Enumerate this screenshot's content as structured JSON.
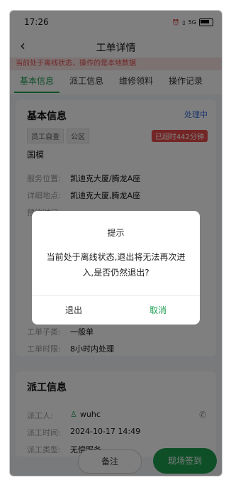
{
  "status_bar": {
    "time": "17:26",
    "icons": [
      "alarm-icon",
      "vibrate-icon",
      "5g-signal-icon",
      "battery-icon"
    ],
    "network": "5G"
  },
  "nav": {
    "title": "工单详情"
  },
  "offline_banner": "当前处于离线状态，操作的是本地数据",
  "tabs": [
    {
      "label": "基本信息",
      "active": true
    },
    {
      "label": "派工信息",
      "active": false
    },
    {
      "label": "维修领料",
      "active": false
    },
    {
      "label": "操作记录",
      "active": false
    }
  ],
  "basic": {
    "title": "基本信息",
    "status": "处理中",
    "tags": [
      "员工自查",
      "公区"
    ],
    "overdue": "已超时442分钟",
    "name": "国模",
    "rows": [
      {
        "label": "服务位置:",
        "value": "凯迪克大厦/腾龙A座"
      },
      {
        "label": "详细地点:",
        "value": "凯迪克大厦,腾龙A座"
      },
      {
        "label": "预约时间:",
        "value": ""
      },
      {
        "label": "工单子类:",
        "value": "一般单"
      },
      {
        "label": "工单时限:",
        "value": "8小时内处理"
      }
    ]
  },
  "dispatch": {
    "title": "派工信息",
    "rows": [
      {
        "label": "派工人:",
        "value": "wuhc"
      },
      {
        "label": "派工时间:",
        "value": "2024-10-17 14:49"
      },
      {
        "label": "派工类型:",
        "value": "无偿服务"
      }
    ]
  },
  "bottom": {
    "note": "备注",
    "checkin": "现场签到"
  },
  "dialog": {
    "title": "提示",
    "message": "当前处于离线状态,退出将无法再次进入,是否仍然退出?",
    "exit": "退出",
    "cancel": "取消"
  },
  "colors": {
    "accent": "#1e9e51",
    "status_blue": "#3a6fd8",
    "overdue_red": "#e84a4a"
  }
}
